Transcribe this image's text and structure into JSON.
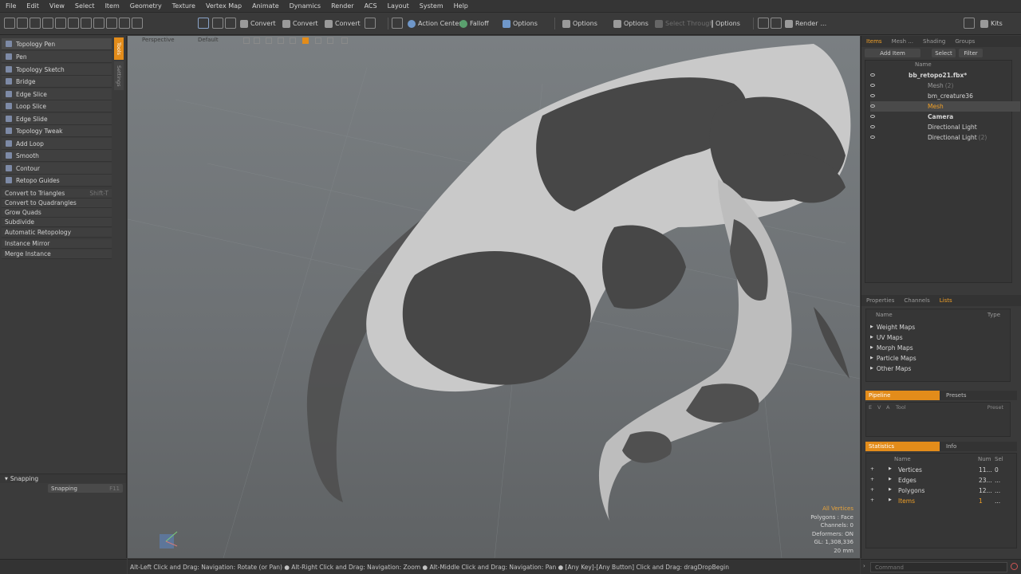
{
  "menu": [
    "File",
    "Edit",
    "View",
    "Select",
    "Item",
    "Geometry",
    "Texture",
    "Vertex Map",
    "Animate",
    "Dynamics",
    "Render",
    "ACS",
    "Layout",
    "System",
    "Help"
  ],
  "toolbar": {
    "convert1": "Convert",
    "convert2": "Convert",
    "convert3": "Convert",
    "action_center": "Action Center",
    "falloff": "Falloff",
    "options1": "Options",
    "options2": "Options",
    "options3": "Options",
    "select_through": "Select Through",
    "options4": "Options",
    "render": "Render",
    "render_more": "...",
    "kits": "Kits"
  },
  "left_panel": {
    "tools": [
      "Topology Pen",
      "Pen",
      "Topology Sketch",
      "Bridge",
      "Edge Slice",
      "Loop Slice",
      "Edge Slide",
      "Topology Tweak",
      "Add Loop",
      "Smooth",
      "Contour",
      "Retopo Guides"
    ],
    "commands": [
      {
        "label": "Convert to Triangles",
        "shortcut": "Shift-T"
      },
      {
        "label": "Convert to Quadrangles",
        "shortcut": ""
      },
      {
        "label": "Grow Quads",
        "shortcut": ""
      },
      {
        "label": "Subdivide",
        "shortcut": ""
      },
      {
        "label": "Automatic Retopology",
        "shortcut": ""
      },
      {
        "label": "Instance Mirror",
        "shortcut": ""
      },
      {
        "label": "Merge Instance",
        "shortcut": ""
      }
    ],
    "side_tabs": [
      "Tools",
      "Settings"
    ],
    "snapping_header": "Snapping",
    "snapping_button": "Snapping",
    "snapping_shortcut": "F11"
  },
  "viewport": {
    "view_name": "Perspective",
    "shading": "Default",
    "info": [
      "All Vertices",
      "Polygons : Face",
      "Channels: 0",
      "Deformers: ON",
      "GL: 1,308,336",
      "20 mm"
    ]
  },
  "items_panel": {
    "tabs": [
      "Items",
      "Mesh ...",
      "Shading",
      "Groups"
    ],
    "add_item": "Add Item",
    "select": "Select",
    "filter": "Filter",
    "name_header": "Name",
    "rows": [
      {
        "name": "bb_retopo21.fbx*",
        "suffix": ""
      },
      {
        "name": "Mesh",
        "suffix": "(2)"
      },
      {
        "name": "bm_creature36",
        "suffix": ""
      },
      {
        "name": "Mesh",
        "suffix": ""
      },
      {
        "name": "Camera",
        "suffix": ""
      },
      {
        "name": "Directional Light",
        "suffix": ""
      },
      {
        "name": "Directional Light",
        "suffix": "(2)"
      }
    ]
  },
  "lists_panel": {
    "tabs": [
      "Properties",
      "Channels",
      "Lists"
    ],
    "name_header": "Name",
    "type_header": "Type",
    "rows": [
      "Weight Maps",
      "UV Maps",
      "Morph Maps",
      "Particle Maps",
      "Other Maps"
    ]
  },
  "pipeline_panel": {
    "tabs": [
      "Pipeline",
      "Presets"
    ],
    "headers": [
      "E",
      "V",
      "A",
      "Tool",
      "Preset"
    ]
  },
  "stats_panel": {
    "tabs": [
      "Statistics",
      "Info"
    ],
    "headers": [
      "Name",
      "Num",
      "Sel"
    ],
    "rows": [
      {
        "name": "Vertices",
        "num": "11...",
        "sel": "0"
      },
      {
        "name": "Edges",
        "num": "23...",
        "sel": "..."
      },
      {
        "name": "Polygons",
        "num": "12...",
        "sel": "..."
      },
      {
        "name": "Items",
        "num": "1",
        "sel": "..."
      }
    ]
  },
  "status_bar": "Alt-Left Click and Drag: Navigation: Rotate (or Pan) ● Alt-Right Click and Drag: Navigation: Zoom ● Alt-Middle Click and Drag: Navigation: Pan ● [Any Key]-[Any Button] Click and Drag: dragDropBegin",
  "command_placeholder": "Command"
}
